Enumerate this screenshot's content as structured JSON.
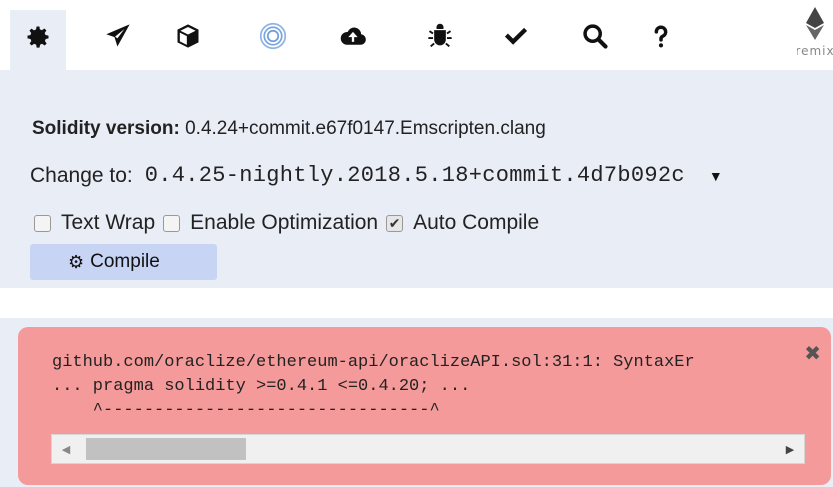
{
  "tabs": [
    {
      "name": "settings",
      "icon": "gear-icon"
    },
    {
      "name": "run",
      "icon": "paper-plane-icon"
    },
    {
      "name": "analysis",
      "icon": "cube-icon"
    },
    {
      "name": "debugger",
      "icon": "target-rings-icon"
    },
    {
      "name": "upload",
      "icon": "cloud-upload-icon"
    },
    {
      "name": "bug",
      "icon": "bug-icon"
    },
    {
      "name": "test",
      "icon": "checkmark-icon"
    },
    {
      "name": "search",
      "icon": "search-icon"
    },
    {
      "name": "help",
      "icon": "question-icon"
    }
  ],
  "logo": {
    "text": "remix"
  },
  "compiler": {
    "version_label": "Solidity version:",
    "version_value": "0.4.24+commit.e67f0147.Emscripten.clang",
    "change_label": "Change to:",
    "change_value": "0.4.25-nightly.2018.5.18+commit.4d7b092c",
    "options": [
      {
        "label": "Text Wrap",
        "checked": false
      },
      {
        "label": "Enable Optimization",
        "checked": false
      },
      {
        "label": "Auto Compile",
        "checked": true
      }
    ],
    "compile_button": "Compile"
  },
  "error": {
    "lines": [
      "github.com/oraclize/ethereum-api/oraclizeAPI.sol:31:1: SyntaxEr",
      "... pragma solidity >=0.4.1 <=0.4.20; ...",
      "    ^--------------------------------^"
    ]
  },
  "colors": {
    "panel_bg": "#e8edf6",
    "error_bg": "#f59a9a",
    "compile_button_bg": "#c8d4f3"
  }
}
